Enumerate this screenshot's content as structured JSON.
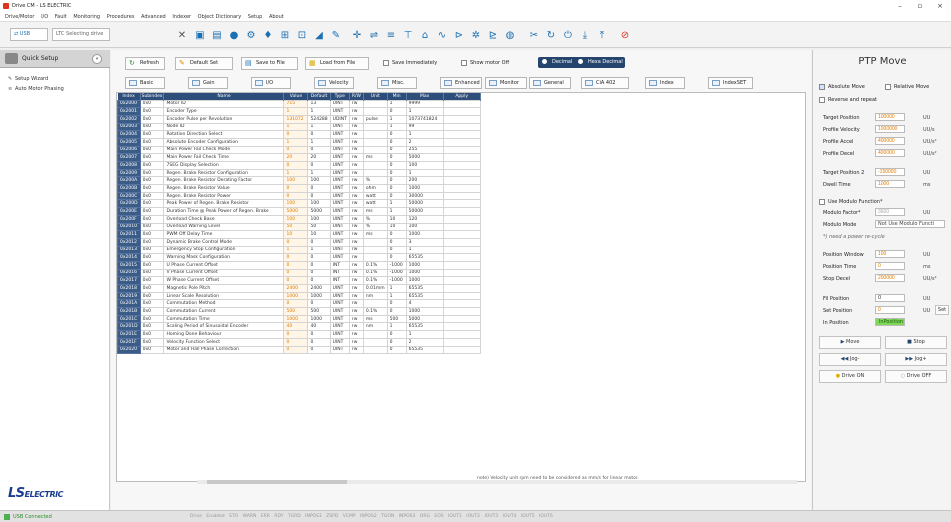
{
  "window": {
    "title": "Drive CM - LS ELECTRIC",
    "minimize": "–",
    "maximize": "▫",
    "close": "×"
  },
  "menu": [
    "Drive/Motor",
    "I/O",
    "Fault",
    "Monitoring",
    "Procedures",
    "Advanced",
    "Indexer",
    "Object Dictionary",
    "Setup",
    "About"
  ],
  "toolbar": {
    "port": "USB",
    "status": "LTC Selecting drive"
  },
  "left": {
    "title": "Quick Setup",
    "items": [
      "Setup Wizard",
      "Auto Motor Phasing"
    ],
    "logo_main": "LS",
    "logo_sub": "ELECTRIC"
  },
  "controls": {
    "refresh": "Refresh",
    "default_set": "Default Set",
    "save_to_file": "Save to File",
    "load_from_file": "Load from File",
    "save_immediately": "Save Immediately",
    "show_motor_off": "Show motor Off",
    "decimal": "Decimal",
    "hexa_decimal": "Hexa Decimal"
  },
  "tabs": [
    "Basic",
    "Gain",
    "I/O",
    "Velocity",
    "Misc.",
    "Enhanced",
    "Monitor",
    "General",
    "CiA 402",
    "Index",
    "IndexSET"
  ],
  "table": {
    "headers": [
      "Index",
      "Subindex",
      "Name",
      "Value",
      "Default",
      "Type",
      "R/W",
      "Unit",
      "Min",
      "Max",
      "Apply"
    ],
    "rows": [
      [
        "0x2000",
        "0x0",
        "Motor ID",
        "715",
        "13",
        "UINT",
        "rw",
        "",
        "1",
        "9999"
      ],
      [
        "0x2001",
        "0x0",
        "Encoder Type",
        "1",
        "1",
        "UINT",
        "rw",
        "",
        "0",
        "1"
      ],
      [
        "0x2002",
        "0x0",
        "Encoder Pulse per Revolution",
        "131072",
        "524288",
        "UDINT",
        "rw",
        "pulse",
        "1",
        "1073741824"
      ],
      [
        "0x2003",
        "0x0",
        "Node ID",
        "1",
        "1",
        "UINT",
        "rw",
        "",
        "1",
        "99"
      ],
      [
        "0x2004",
        "0x0",
        "Rotation Direction Select",
        "0",
        "0",
        "UINT",
        "rw",
        "",
        "0",
        "1"
      ],
      [
        "0x2005",
        "0x0",
        "Absolute Encoder Configuration",
        "1",
        "1",
        "UINT",
        "rw",
        "",
        "0",
        "2"
      ],
      [
        "0x2006",
        "0x0",
        "Main Power Fail Check Mode",
        "0",
        "0",
        "UINT",
        "rw",
        "",
        "0",
        "255"
      ],
      [
        "0x2007",
        "0x0",
        "Main Power Fail Check Time",
        "20",
        "20",
        "UINT",
        "rw",
        "ms",
        "0",
        "5000"
      ],
      [
        "0x2008",
        "0x0",
        "7SEG Display Selection",
        "0",
        "0",
        "UINT",
        "rw",
        "",
        "0",
        "100"
      ],
      [
        "0x2009",
        "0x0",
        "Regen. Brake Resistor Configuration",
        "1",
        "1",
        "UINT",
        "rw",
        "",
        "0",
        "1"
      ],
      [
        "0x200A",
        "0x0",
        "Regen. Brake Resistor Derating Factor",
        "100",
        "100",
        "UINT",
        "rw",
        "%",
        "0",
        "200"
      ],
      [
        "0x200B",
        "0x0",
        "Regen. Brake Resistor Value",
        "0",
        "0",
        "UINT",
        "rw",
        "ohm",
        "0",
        "1000"
      ],
      [
        "0x200C",
        "0x0",
        "Regen. Brake Resistor Power",
        "0",
        "0",
        "UINT",
        "rw",
        "watt",
        "0",
        "30000"
      ],
      [
        "0x200D",
        "0x0",
        "Peak Power of Regen. Brake Resistor",
        "100",
        "100",
        "UINT",
        "rw",
        "watt",
        "1",
        "50000"
      ],
      [
        "0x200E",
        "0x0",
        "Duration Time @ Peak Power of Regen. Brake",
        "5000",
        "5000",
        "UINT",
        "rw",
        "ms",
        "1",
        "50000"
      ],
      [
        "0x200F",
        "0x0",
        "Overload Check Base",
        "100",
        "100",
        "UINT",
        "rw",
        "%",
        "10",
        "120"
      ],
      [
        "0x2010",
        "0x0",
        "Overload Warning Level",
        "50",
        "50",
        "UINT",
        "rw",
        "%",
        "10",
        "100"
      ],
      [
        "0x2011",
        "0x0",
        "PWM Off Delay Time",
        "10",
        "10",
        "UINT",
        "rw",
        "ms",
        "0",
        "1000"
      ],
      [
        "0x2012",
        "0x0",
        "Dynamic Brake Control Mode",
        "0",
        "0",
        "UINT",
        "rw",
        "",
        "0",
        "3"
      ],
      [
        "0x2013",
        "0x0",
        "Emergency Stop Configuration",
        "1",
        "1",
        "UINT",
        "rw",
        "",
        "0",
        "1"
      ],
      [
        "0x2014",
        "0x0",
        "Warning Mask Configuration",
        "0",
        "0",
        "UINT",
        "rw",
        "",
        "0",
        "65535"
      ],
      [
        "0x2015",
        "0x0",
        "U Phase Current Offset",
        "0",
        "0",
        "INT",
        "rw",
        "0.1%",
        "-1000",
        "1000"
      ],
      [
        "0x2016",
        "0x0",
        "V Phase Current Offset",
        "0",
        "0",
        "INT",
        "rw",
        "0.1%",
        "-1000",
        "1000"
      ],
      [
        "0x2017",
        "0x0",
        "W Phase Current Offset",
        "0",
        "0",
        "INT",
        "rw",
        "0.1%",
        "-1000",
        "1000"
      ],
      [
        "0x2018",
        "0x0",
        "Magnetic Pole Pitch",
        "2400",
        "2400",
        "UINT",
        "rw",
        "0.01mm",
        "1",
        "65535"
      ],
      [
        "0x2019",
        "0x0",
        "Linear Scale Resolution",
        "1000",
        "1000",
        "UINT",
        "rw",
        "nm",
        "1",
        "65535"
      ],
      [
        "0x201A",
        "0x0",
        "Commutation Method",
        "0",
        "0",
        "UINT",
        "rw",
        "",
        "0",
        "4"
      ],
      [
        "0x201B",
        "0x0",
        "Commutation Current",
        "500",
        "500",
        "UINT",
        "rw",
        "0.1%",
        "0",
        "1000"
      ],
      [
        "0x201C",
        "0x0",
        "Commutation Time",
        "1000",
        "1000",
        "UINT",
        "rw",
        "ms",
        "500",
        "5000"
      ],
      [
        "0x201D",
        "0x0",
        "Scaling Period of Sinusoidal Encoder",
        "40",
        "40",
        "UINT",
        "rw",
        "nm",
        "1",
        "65535"
      ],
      [
        "0x201E",
        "0x0",
        "Homing Done Behaviour",
        "0",
        "0",
        "UINT",
        "rw",
        "",
        "0",
        "1"
      ],
      [
        "0x201F",
        "0x0",
        "Velocity Function Select",
        "0",
        "0",
        "UINT",
        "rw",
        "",
        "0",
        "2"
      ],
      [
        "0x2020",
        "0x0",
        "Motor and Hall Phase Correction",
        "0",
        "0",
        "UINT",
        "rw",
        "",
        "0",
        "65535"
      ]
    ],
    "note": "note) Velocity unit rpm need to be considered as mm/s for linear motor."
  },
  "ptp": {
    "title": "PTP Move",
    "absolute_move": "Absolute Move",
    "relative_move": "Relative Move",
    "reverse_repeat": "Reverse and repeat",
    "fields": [
      {
        "label": "Target Position",
        "value": "100000",
        "unit": "UU"
      },
      {
        "label": "Profile Velocity",
        "value": "1000000",
        "unit": "UU/s"
      },
      {
        "label": "Profile Accel",
        "value": "400000",
        "unit": "UU/s²"
      },
      {
        "label": "Profile Decel",
        "value": "400000",
        "unit": "UU/s²"
      },
      {
        "label": "Target Position 2",
        "value": "-150000",
        "unit": "UU"
      },
      {
        "label": "Dwell Time",
        "value": "1000",
        "unit": "ms"
      }
    ],
    "modulo_func": "Use Modulo Function*",
    "modulo_factor_label": "Modulo Factor*",
    "modulo_factor": "3600",
    "modulo_factor_unit": "UU",
    "modulo_mode_label": "Modulo Mode",
    "modulo_mode": "Not Use Modulo Functi",
    "power_cycle_note": "*) need a power re-cycle",
    "fields2": [
      {
        "label": "Position Window",
        "value": "100",
        "unit": "UU"
      },
      {
        "label": "Position Time",
        "value": "0",
        "unit": "ms"
      },
      {
        "label": "Stop Decel",
        "value": "200000",
        "unit": "UU/s²"
      }
    ],
    "fil_position_label": "Fil Position",
    "fil_position": "0",
    "fil_unit": "UU",
    "set_position_label": "Set Position",
    "set_position": "0",
    "set_unit": "UU",
    "set_btn": "Set",
    "in_position_label": "In Position",
    "in_position": "InPosition",
    "move": "Move",
    "stop": "Stop",
    "jog_minus": "Jog-",
    "jog_plus": "Jog+",
    "drive_on": "Drive ON",
    "drive_off": "Drive OFF"
  },
  "status": {
    "connection": "USB Connected",
    "signals": "Drive Enabled STO WARN ERR RDY TGRD INPOS1 ZSPD VCMP INPOS2 TGON INPOS3 ORG EOS IOUT1 IOUT2 IOUT3 IOUT4 IOUT5 IOUT6"
  }
}
